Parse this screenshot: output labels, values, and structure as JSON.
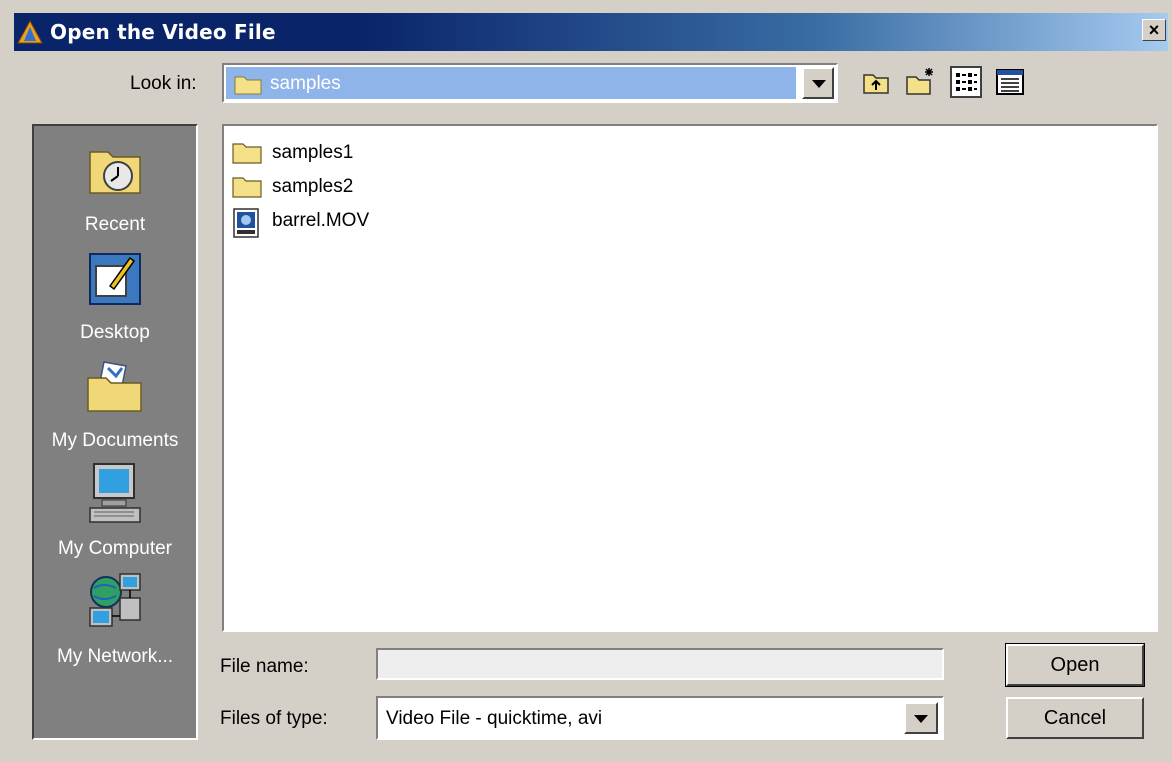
{
  "window": {
    "title": "Open the Video File",
    "close_glyph": "×"
  },
  "lookin": {
    "label": "Look in:",
    "value": "samples"
  },
  "toolbar": {
    "icons": [
      "up-one-level-icon",
      "new-folder-icon",
      "list-view-icon",
      "details-view-icon"
    ]
  },
  "places": [
    {
      "label": "Recent",
      "icon": "recent-icon"
    },
    {
      "label": "Desktop",
      "icon": "desktop-icon"
    },
    {
      "label": "My Documents",
      "icon": "my-documents-icon"
    },
    {
      "label": "My Computer",
      "icon": "my-computer-icon"
    },
    {
      "label": "My Network...",
      "icon": "my-network-icon"
    }
  ],
  "files": [
    {
      "name": "samples1",
      "type": "folder"
    },
    {
      "name": "samples2",
      "type": "folder"
    },
    {
      "name": "barrel.MOV",
      "type": "video"
    }
  ],
  "filename": {
    "label": "File name:",
    "value": "",
    "placeholder": ""
  },
  "filetype": {
    "label": "Files of type:",
    "value": "Video File - quicktime, avi"
  },
  "buttons": {
    "open": "Open",
    "cancel": "Cancel"
  },
  "colors": {
    "title_bar": "#0a246a",
    "dialog_bg": "#d4d0c8",
    "places_bg": "#808080",
    "selection": "#8eb4ea"
  }
}
